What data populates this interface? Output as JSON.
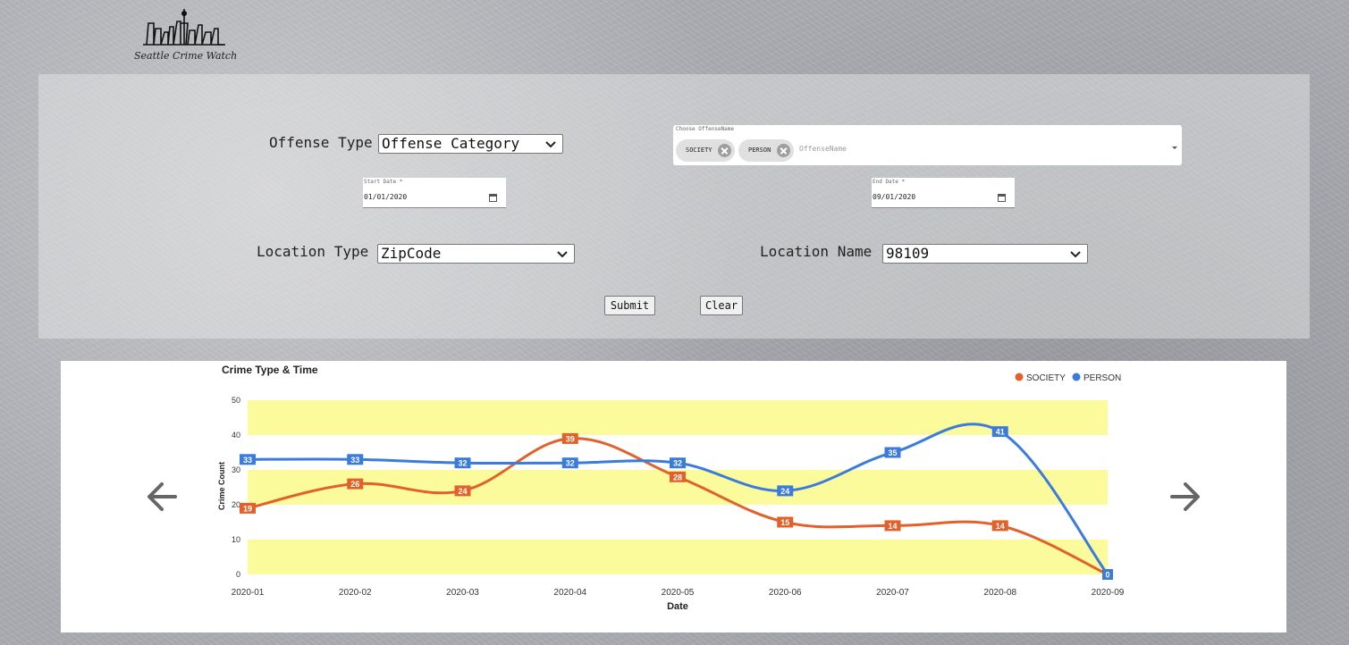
{
  "logo": {
    "text": "Seattle Crime Watch"
  },
  "offense_type": {
    "label": "Offense Type",
    "value": "Offense Category"
  },
  "offense_name": {
    "label": "Choose OffenseName",
    "chips": [
      "SOCIETY",
      "PERSON"
    ],
    "placeholder": "OffenseName"
  },
  "start_date": {
    "label": "Start Date *",
    "value": "01/01/2020"
  },
  "end_date": {
    "label": "End Date *",
    "value": "09/01/2020"
  },
  "location_type": {
    "label": "Location Type",
    "value": "ZipCode"
  },
  "location_name": {
    "label": "Location Name",
    "value": "98109"
  },
  "buttons": {
    "submit": "Submit",
    "clear": "Clear"
  },
  "icons": {
    "prev": "arrow-left-icon",
    "next": "arrow-right-icon",
    "dropdown": "chevron-down-icon",
    "calendar": "calendar-icon"
  },
  "chart_data": {
    "type": "line",
    "title": "Crime Type & Time",
    "xlabel": "Date",
    "ylabel": "Crime Count",
    "ylim": [
      0,
      50
    ],
    "yticks": [
      0,
      10,
      20,
      30,
      40,
      50
    ],
    "categories": [
      "2020-01",
      "2020-02",
      "2020-03",
      "2020-04",
      "2020-05",
      "2020-06",
      "2020-07",
      "2020-08",
      "2020-09"
    ],
    "series": [
      {
        "name": "SOCIETY",
        "color": "#e2612b",
        "values": [
          19,
          26,
          24,
          39,
          28,
          15,
          14,
          14,
          0
        ]
      },
      {
        "name": "PERSON",
        "color": "#3a7bdc",
        "values": [
          33,
          33,
          32,
          32,
          32,
          24,
          35,
          41,
          0
        ]
      }
    ],
    "band_color": "#fbfb9c",
    "legend": "top-right",
    "grid": false
  }
}
